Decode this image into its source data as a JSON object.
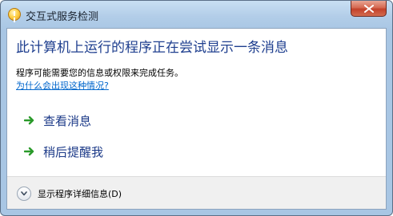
{
  "window": {
    "title": "交互式服务检测",
    "close_icon": "close-x-icon",
    "title_icon": "warning-shield-icon"
  },
  "main": {
    "heading": "此计算机上运行的程序正在尝试显示一条消息",
    "description": "程序可能需要您的信息或权限来完成任务。",
    "why_link": "为什么会出现这种情况?"
  },
  "commands": [
    {
      "label": "查看消息",
      "icon": "green-arrow-icon"
    },
    {
      "label": "稍后提醒我",
      "icon": "green-arrow-icon"
    }
  ],
  "footer": {
    "details_label": "显示程序详细信息(D)",
    "expander_icon": "chevron-down-icon"
  },
  "colors": {
    "heading": "#1f3f8f",
    "link": "#0066cc",
    "command": "#1c3a88",
    "arrow": "#2a9a2a",
    "close_button": "#c3412a"
  }
}
